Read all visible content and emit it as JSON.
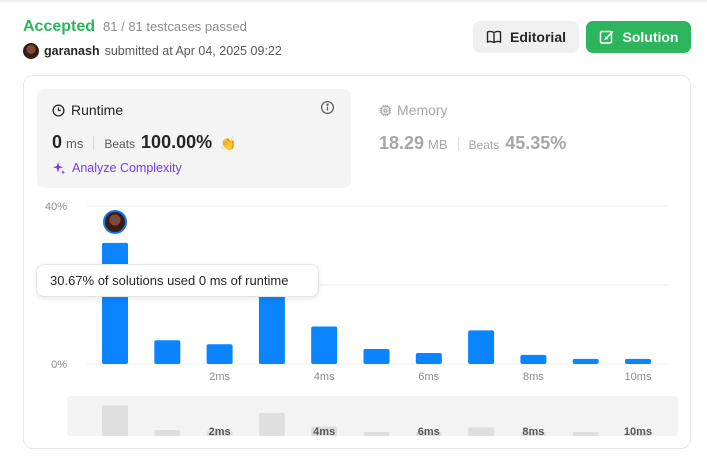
{
  "header": {
    "status": "Accepted",
    "tests_passed": "81 / 81 testcases passed",
    "username": "garanash",
    "submitted_text": "submitted at Apr 04, 2025 09:22"
  },
  "buttons": {
    "editorial": "Editorial",
    "solution": "Solution"
  },
  "runtime": {
    "title": "Runtime",
    "value": "0",
    "unit": "ms",
    "beats_label": "Beats",
    "beats_value": "100.00%",
    "analyze_label": "Analyze Complexity",
    "icon": "clock-icon"
  },
  "memory": {
    "title": "Memory",
    "value": "18.29",
    "unit": "MB",
    "beats_label": "Beats",
    "beats_value": "45.35%",
    "icon": "chip-icon"
  },
  "tooltip": "30.67% of solutions used 0 ms of runtime",
  "colors": {
    "accent_green": "#2db55d",
    "bar_blue": "#0a84ff",
    "muted_text": "#a6a6a6",
    "analyze_purple": "#7c3aed"
  },
  "chart_data": {
    "type": "bar",
    "ylabels": [
      "40%",
      "0%"
    ],
    "xlabels": [
      "2ms",
      "4ms",
      "6ms",
      "8ms",
      "10ms"
    ],
    "ylim": [
      0,
      40
    ],
    "grid": true,
    "values": [
      30.67,
      6,
      5,
      23,
      9.5,
      3.8,
      2.8,
      8.5,
      2.3,
      1.3,
      1.3
    ],
    "overview_xlabels": [
      "2ms",
      "4ms",
      "6ms",
      "8ms",
      "10ms"
    ]
  }
}
